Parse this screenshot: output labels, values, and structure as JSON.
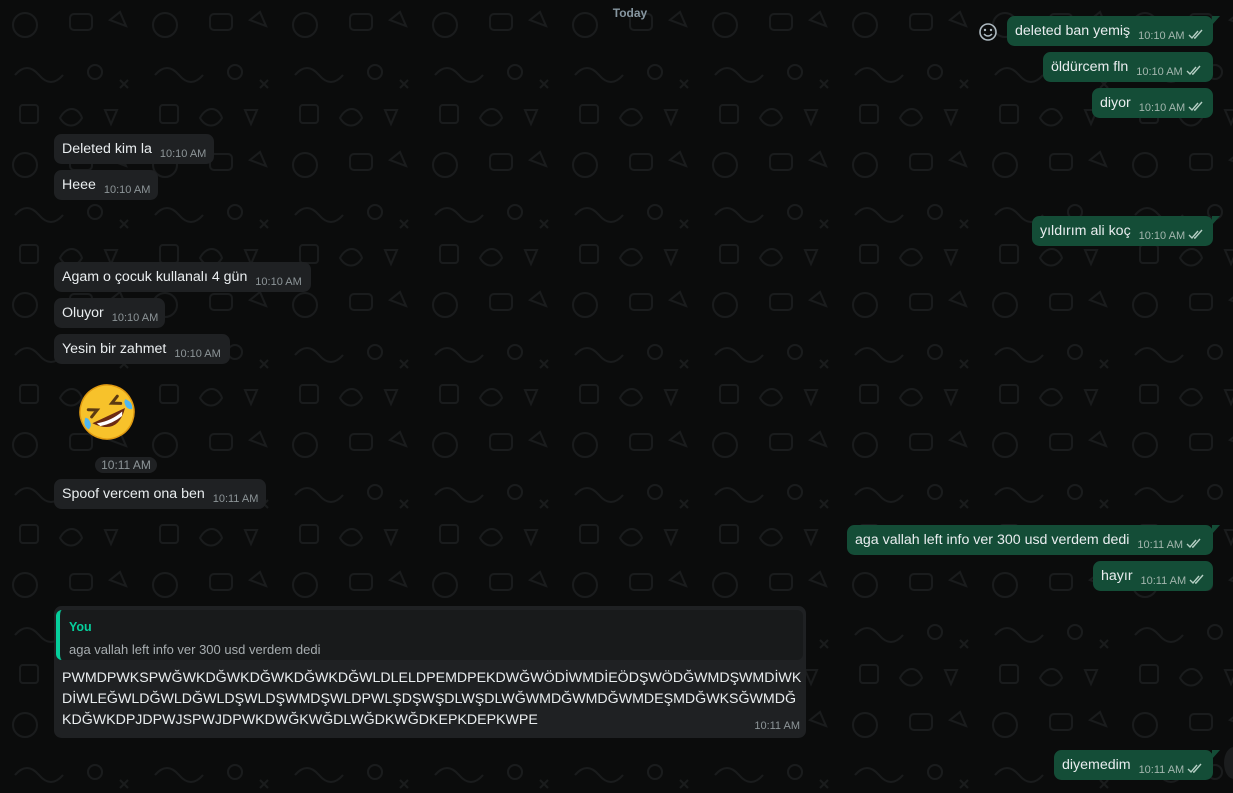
{
  "date_divider": "Today",
  "colors": {
    "outgoing": "#144d37",
    "incoming": "#1f2123",
    "accent": "#06cf9c",
    "tick": "#b5cfc4"
  },
  "messages_outgoing": [
    {
      "text": "deleted ban yemiş",
      "time": "10:10 AM"
    },
    {
      "text": "öldürcem fln",
      "time": "10:10 AM"
    },
    {
      "text": "diyor",
      "time": "10:10 AM"
    },
    {
      "text": "yıldırım ali koç",
      "time": "10:10 AM"
    },
    {
      "text": "aga vallah left info ver 300 usd verdem dedi",
      "time": "10:11 AM"
    },
    {
      "text": "hayır",
      "time": "10:11 AM"
    },
    {
      "text": "diyemedim",
      "time": "10:11 AM"
    }
  ],
  "messages_incoming": [
    {
      "text": "Deleted kim la",
      "time": "10:10 AM"
    },
    {
      "text": "Heee",
      "time": "10:10 AM"
    },
    {
      "text": "Agam o çocuk kullanalı 4 gün",
      "time": "10:10 AM"
    },
    {
      "text": "Oluyor",
      "time": "10:10 AM"
    },
    {
      "text": "Yesin bir zahmet",
      "time": "10:10 AM"
    },
    {
      "text": "Spoof vercem ona ben",
      "time": "10:11 AM"
    }
  ],
  "sticker": {
    "icon": "rolling-on-floor-laughing-emoji",
    "time": "10:11 AM"
  },
  "reply": {
    "quoted_author": "You",
    "quoted_text": "aga vallah left info ver 300 usd verdem dedi",
    "text": "PWMDPWKSPWĞWKDĞWKDĞWKDĞWKDĞWLDLELDPEMDPEKDWĞWÖDİWMDİEÖDŞWÖDĞWMDŞWMDİWKDİWLEĞWLDĞWLDĞWLDŞWLDŞWMDŞWLDPWLŞDŞWŞDLWŞDLWĞWMDĞWMDĞWMDEŞMDĞWKSĞWMDĞKDĞWKDPJDPWJSPWJDPWKDWĞKWĞDLWĞDKWĞDKEPKDEPKWPE",
    "time": "10:11 AM"
  }
}
